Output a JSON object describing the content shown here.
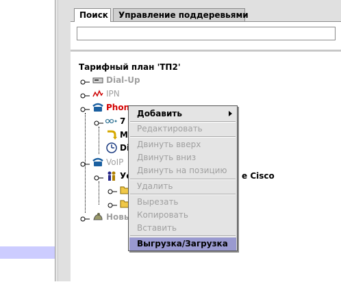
{
  "tabs": {
    "search": "Поиск",
    "subtrees": "Управление поддеревьями"
  },
  "search": {
    "value": ""
  },
  "tree": {
    "root": "Тарифный план 'ТП2'",
    "dialup": "Dial-Up",
    "ipn": "IPN",
    "phone": "Phone",
    "child_num": "7",
    "child_mi": "Mi",
    "child_di": "Di",
    "voip": "VoIP",
    "voip_child": "Уc",
    "voip_child_tail": "e Cisco",
    "new": "Новы"
  },
  "context_menu": {
    "items": [
      {
        "label": "Добавить"
      },
      {
        "label": "Редактировать"
      },
      {
        "label": "Двинуть вверх"
      },
      {
        "label": "Двинуть вниз"
      },
      {
        "label": "Двинуть на позицию"
      },
      {
        "label": "Удалить"
      },
      {
        "label": "Вырезать"
      },
      {
        "label": "Копировать"
      },
      {
        "label": "Вставить"
      },
      {
        "label": "Выгрузка/Загрузка"
      }
    ]
  },
  "colors": {
    "selection": "#9a9ad0",
    "left_selection": "#ccccff",
    "phone_text": "#d40000",
    "disabled_text": "#a0a0a0"
  }
}
